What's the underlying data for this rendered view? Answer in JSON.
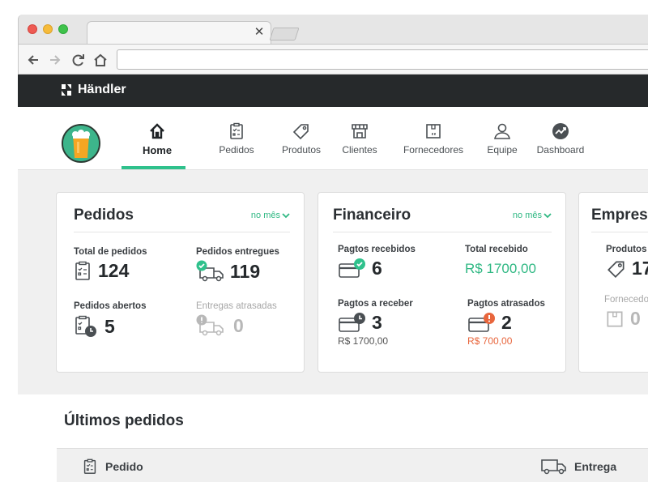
{
  "app": {
    "brand": "Händler"
  },
  "nav": {
    "items": [
      {
        "label": "Home",
        "icon": "home-icon",
        "active": true
      },
      {
        "label": "Pedidos",
        "icon": "clipboard-icon"
      },
      {
        "label": "Produtos",
        "icon": "tag-icon"
      },
      {
        "label": "Clientes",
        "icon": "store-icon"
      },
      {
        "label": "Fornecedores",
        "icon": "box-icon"
      },
      {
        "label": "Equipe",
        "icon": "user-icon"
      },
      {
        "label": "Dashboard",
        "icon": "chart-icon"
      }
    ]
  },
  "cards": {
    "pedidos": {
      "title": "Pedidos",
      "filter": "no mês",
      "total_label": "Total de pedidos",
      "total_value": "124",
      "entregues_label": "Pedidos entregues",
      "entregues_value": "119",
      "abertos_label": "Pedidos abertos",
      "abertos_value": "5",
      "atrasadas_label": "Entregas atrasadas",
      "atrasadas_value": "0"
    },
    "financeiro": {
      "title": "Financeiro",
      "filter": "no mês",
      "pagtos_recebidos_label": "Pagtos recebidos",
      "pagtos_recebidos_value": "6",
      "total_recebido_label": "Total recebido",
      "total_recebido_value": "R$ 1700,00",
      "pagtos_receber_label": "Pagtos a receber",
      "pagtos_receber_value": "3",
      "pagtos_receber_amount": "R$ 1700,00",
      "pagtos_atrasados_label": "Pagtos atrasados",
      "pagtos_atrasados_value": "2",
      "pagtos_atrasados_amount": "R$ 700,00"
    },
    "empresa": {
      "title": "Empresa",
      "produtos_label": "Produtos",
      "produtos_value": "17",
      "fornecedores_label": "Fornecedo",
      "fornecedores_value": "0"
    }
  },
  "latest": {
    "title": "Últimos pedidos",
    "col_pedido": "Pedido",
    "col_entrega": "Entrega"
  },
  "colors": {
    "accent": "#2fc18c",
    "header": "#26292b",
    "alert": "#e8663d"
  }
}
